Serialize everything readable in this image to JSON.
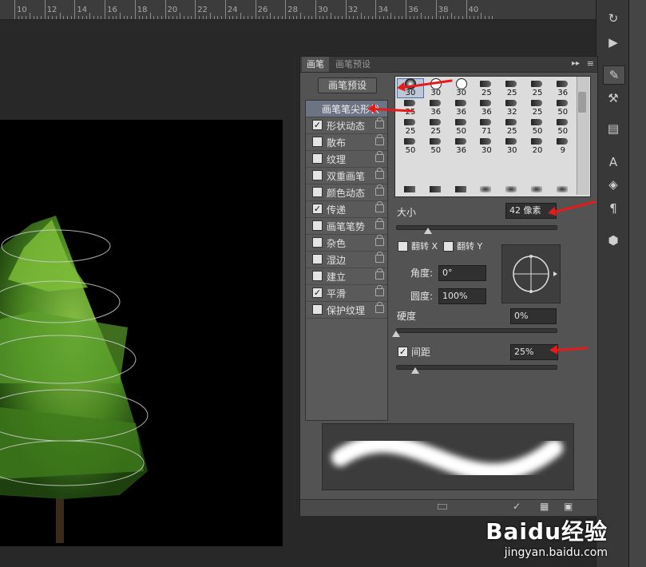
{
  "ruler": {
    "labels": [
      "10",
      "12",
      "14",
      "16",
      "18",
      "20",
      "22",
      "24",
      "26",
      "28",
      "30",
      "32",
      "34",
      "36",
      "38",
      "40"
    ]
  },
  "panel": {
    "tabs": {
      "active": "画笔",
      "inactive": "画笔预设"
    },
    "presets_button": "画笔预设",
    "options": [
      {
        "label": "画笔笔尖形状",
        "checkbox": false,
        "checked": false,
        "lock": false,
        "header": true
      },
      {
        "label": "形状动态",
        "checkbox": true,
        "checked": true,
        "lock": true
      },
      {
        "label": "散布",
        "checkbox": true,
        "checked": false,
        "lock": true
      },
      {
        "label": "纹理",
        "checkbox": true,
        "checked": false,
        "lock": true
      },
      {
        "label": "双重画笔",
        "checkbox": true,
        "checked": false,
        "lock": true
      },
      {
        "label": "颜色动态",
        "checkbox": true,
        "checked": false,
        "lock": true
      },
      {
        "label": "传递",
        "checkbox": true,
        "checked": true,
        "lock": true
      },
      {
        "label": "画笔笔势",
        "checkbox": true,
        "checked": false,
        "lock": true
      },
      {
        "label": "杂色",
        "checkbox": true,
        "checked": false,
        "lock": true
      },
      {
        "label": "湿边",
        "checkbox": true,
        "checked": false,
        "lock": true
      },
      {
        "label": "建立",
        "checkbox": true,
        "checked": false,
        "lock": true
      },
      {
        "label": "平滑",
        "checkbox": true,
        "checked": true,
        "lock": true
      },
      {
        "label": "保护纹理",
        "checkbox": true,
        "checked": false,
        "lock": true
      }
    ],
    "brush_grid": [
      [
        "30",
        "30",
        "30",
        "25",
        "25",
        "25",
        "36"
      ],
      [
        "25",
        "36",
        "36",
        "36",
        "32",
        "25",
        "50"
      ],
      [
        "25",
        "25",
        "50",
        "71",
        "25",
        "50",
        "50"
      ],
      [
        "50",
        "50",
        "36",
        "30",
        "30",
        "20",
        "9"
      ]
    ],
    "size_label": "大小",
    "size_value": "42 像素",
    "flip_x_label": "翻转 X",
    "flip_y_label": "翻转 Y",
    "angle_label": "角度:",
    "angle_value": "0°",
    "roundness_label": "圆度:",
    "roundness_value": "100%",
    "hardness_label": "硬度",
    "hardness_value": "0%",
    "spacing_label": "间距",
    "spacing_value": "25%",
    "spacing_checked": true,
    "slider_levels": {
      "size": 0.2,
      "hardness": 0.0,
      "spacing": 0.12
    }
  },
  "watermark": {
    "logo": "Baidu经验",
    "url": "jingyan.baidu.com"
  },
  "colors": {
    "arrow": "#e31b1b",
    "panel_bg": "#535353",
    "grid_bg": "#dcdcdc"
  }
}
